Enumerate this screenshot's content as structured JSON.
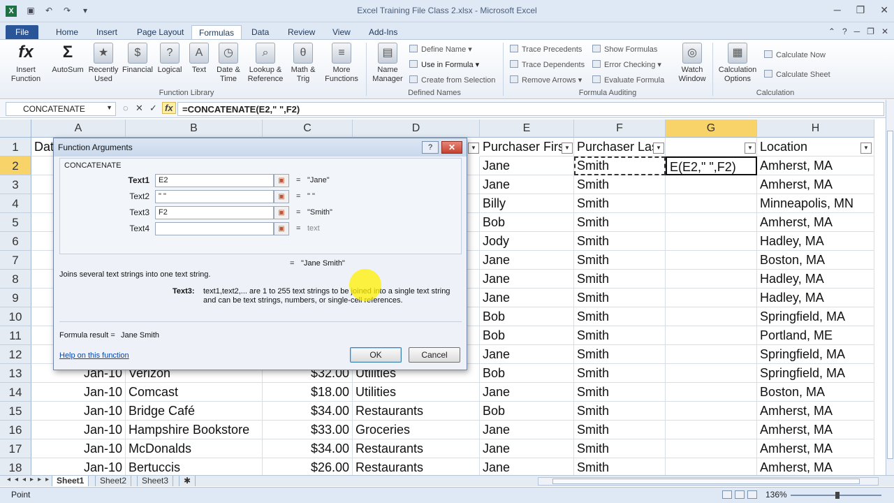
{
  "window": {
    "title": "Excel Training File Class 2.xlsx - Microsoft Excel",
    "app_icon": "X"
  },
  "ribbon_tabs": [
    "File",
    "Home",
    "Insert",
    "Page Layout",
    "Formulas",
    "Data",
    "Review",
    "View",
    "Add-Ins"
  ],
  "ribbon": {
    "insert_function": "Insert Function",
    "autosum": "AutoSum",
    "recently_used": "Recently Used",
    "financial": "Financial",
    "logical": "Logical",
    "text": "Text",
    "date_time": "Date & Time",
    "lookup_reference": "Lookup & Reference",
    "math_trig": "Math & Trig",
    "more_functions": "More Functions",
    "function_library": "Function Library",
    "name_manager": "Name Manager",
    "define_name": "Define Name",
    "use_in_formula": "Use in Formula",
    "create_from_selection": "Create from Selection",
    "defined_names": "Defined Names",
    "trace_precedents": "Trace Precedents",
    "trace_dependents": "Trace Dependents",
    "remove_arrows": "Remove Arrows",
    "show_formulas": "Show Formulas",
    "error_checking": "Error Checking",
    "evaluate_formula": "Evaluate Formula",
    "watch_window": "Watch Window",
    "formula_auditing": "Formula Auditing",
    "calculation_options": "Calculation Options",
    "calculate_now": "Calculate Now",
    "calculate_sheet": "Calculate Sheet",
    "calculation": "Calculation"
  },
  "formula_bar": {
    "name_box": "CONCATENATE",
    "formula": "=CONCATENATE(E2,\" \",F2)"
  },
  "columns": [
    "A",
    "B",
    "C",
    "D",
    "E",
    "F",
    "G",
    "H"
  ],
  "header_row": {
    "a": "Dat",
    "e": "Purchaser Firs",
    "f": "Purchaser Las",
    "g2": "E(E2,\" \",F2)",
    "h": "Location"
  },
  "rows": [
    {
      "num": "2",
      "a": "",
      "b": "",
      "c": "",
      "d": "",
      "e": "Jane",
      "f": "Smith",
      "h": "Amherst, MA"
    },
    {
      "num": "3",
      "a": "",
      "b": "",
      "c": "",
      "d": "",
      "e": "Jane",
      "f": "Smith",
      "h": "Amherst, MA"
    },
    {
      "num": "4",
      "a": "",
      "b": "",
      "c": "",
      "d": "",
      "e": "Billy",
      "f": "Smith",
      "h": "Minneapolis, MN"
    },
    {
      "num": "5",
      "a": "",
      "b": "",
      "c": "",
      "d": "",
      "e": "Bob",
      "f": "Smith",
      "h": "Amherst, MA"
    },
    {
      "num": "6",
      "a": "",
      "b": "",
      "c": "",
      "d": "",
      "e": "Jody",
      "f": "Smith",
      "h": "Hadley, MA"
    },
    {
      "num": "7",
      "a": "",
      "b": "",
      "c": "",
      "d": "",
      "e": "Jane",
      "f": "Smith",
      "h": "Boston, MA"
    },
    {
      "num": "8",
      "a": "",
      "b": "",
      "c": "",
      "d": "",
      "e": "Jane",
      "f": "Smith",
      "h": "Hadley, MA"
    },
    {
      "num": "9",
      "a": "",
      "b": "",
      "c": "",
      "d": "",
      "e": "Jane",
      "f": "Smith",
      "h": "Hadley, MA"
    },
    {
      "num": "10",
      "a": "",
      "b": "",
      "c": "",
      "d": "",
      "e": "Bob",
      "f": "Smith",
      "h": "Springfield, MA"
    },
    {
      "num": "11",
      "a": "",
      "b": "",
      "c": "",
      "d": "",
      "e": "Bob",
      "f": "Smith",
      "h": "Portland, ME"
    },
    {
      "num": "12",
      "a": "",
      "b": "",
      "c": "",
      "d": "",
      "e": "Jane",
      "f": "Smith",
      "h": "Springfield, MA"
    },
    {
      "num": "13",
      "a": "Jan-10",
      "b": "Verizon",
      "c": "$32.00",
      "d": "Utilities",
      "e": "Bob",
      "f": "Smith",
      "h": "Springfield, MA"
    },
    {
      "num": "14",
      "a": "Jan-10",
      "b": "Comcast",
      "c": "$18.00",
      "d": "Utilities",
      "e": "Jane",
      "f": "Smith",
      "h": "Boston, MA"
    },
    {
      "num": "15",
      "a": "Jan-10",
      "b": "Bridge Café",
      "c": "$34.00",
      "d": "Restaurants",
      "e": "Bob",
      "f": "Smith",
      "h": "Amherst, MA"
    },
    {
      "num": "16",
      "a": "Jan-10",
      "b": "Hampshire Bookstore",
      "c": "$33.00",
      "d": "Groceries",
      "e": "Jane",
      "f": "Smith",
      "h": "Amherst, MA"
    },
    {
      "num": "17",
      "a": "Jan-10",
      "b": "McDonalds",
      "c": "$34.00",
      "d": "Restaurants",
      "e": "Jane",
      "f": "Smith",
      "h": "Amherst, MA"
    },
    {
      "num": "18",
      "a": "Jan-10",
      "b": "Bertuccis",
      "c": "$26.00",
      "d": "Restaurants",
      "e": "Jane",
      "f": "Smith",
      "h": "Amherst, MA"
    }
  ],
  "row_header_1": "1",
  "dialog": {
    "title": "Function Arguments",
    "function": "CONCATENATE",
    "args": [
      {
        "label": "Text1",
        "value": "E2",
        "result": "\"Jane\""
      },
      {
        "label": "Text2",
        "value": "\" \"",
        "result": "\" \""
      },
      {
        "label": "Text3",
        "value": "F2",
        "result": "\"Smith\""
      },
      {
        "label": "Text4",
        "value": "",
        "result": "text"
      }
    ],
    "eq": "=",
    "total_result": "\"Jane Smith\"",
    "description": "Joins several text strings into one text string.",
    "arg_name": "Text3:",
    "arg_help": "text1,text2,... are 1 to 255 text strings to be joined into a single text string and can be text strings, numbers, or single-cell references.",
    "formula_result_label": "Formula result =",
    "formula_result": "Jane Smith",
    "help_link": "Help on this function",
    "ok": "OK",
    "cancel": "Cancel",
    "help_btn": "?",
    "close_btn": "✕"
  },
  "sheets": [
    "Sheet1",
    "Sheet2",
    "Sheet3"
  ],
  "status": {
    "mode": "Point",
    "zoom": "136%"
  }
}
